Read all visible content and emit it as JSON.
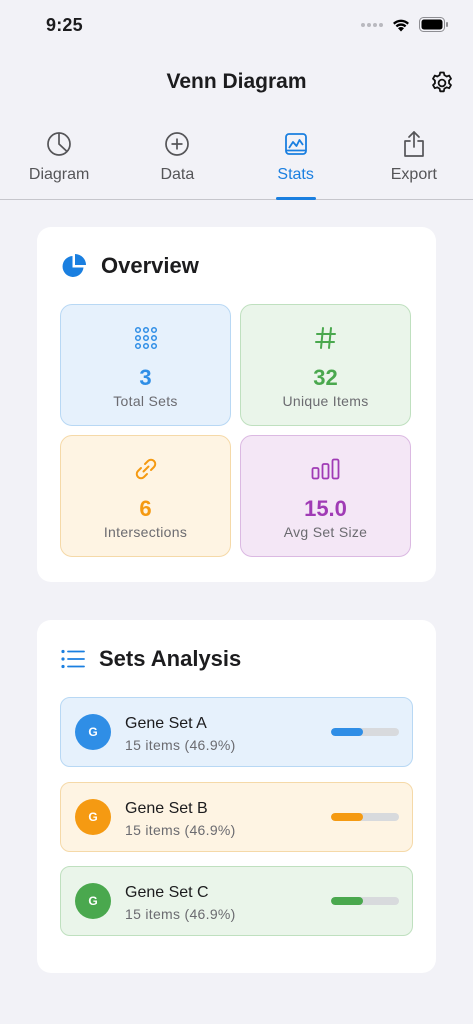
{
  "status": {
    "time": "9:25"
  },
  "nav": {
    "title": "Venn Diagram",
    "settings_icon": "gear-icon"
  },
  "tabs": [
    {
      "label": "Diagram",
      "icon": "pie-chart-icon",
      "active": false
    },
    {
      "label": "Data",
      "icon": "plus-circle-icon",
      "active": false
    },
    {
      "label": "Stats",
      "icon": "chart-image-icon",
      "active": true
    },
    {
      "label": "Export",
      "icon": "share-icon",
      "active": false
    }
  ],
  "overview": {
    "title": "Overview",
    "icon": "pie-chart-icon",
    "stats": [
      {
        "value": "3",
        "label": "Total Sets",
        "icon": "grid-dots-icon",
        "color": "#2f8ee6"
      },
      {
        "value": "32",
        "label": "Unique Items",
        "icon": "hash-icon",
        "color": "#4aa84e"
      },
      {
        "value": "6",
        "label": "Intersections",
        "icon": "link-icon",
        "color": "#f59a12"
      },
      {
        "value": "15.0",
        "label": "Avg Set Size",
        "icon": "bar-chart-icon",
        "color": "#a03bb5"
      }
    ]
  },
  "sets_analysis": {
    "title": "Sets Analysis",
    "icon": "list-icon",
    "sets": [
      {
        "initial": "G",
        "name": "Gene Set A",
        "count": "15 items (46.9%)",
        "fraction": 0.469,
        "color": "#2f8ee6"
      },
      {
        "initial": "G",
        "name": "Gene Set B",
        "count": "15 items (46.9%)",
        "fraction": 0.469,
        "color": "#f59a12"
      },
      {
        "initial": "G",
        "name": "Gene Set C",
        "count": "15 items (46.9%)",
        "fraction": 0.469,
        "color": "#4aa84e"
      }
    ]
  }
}
